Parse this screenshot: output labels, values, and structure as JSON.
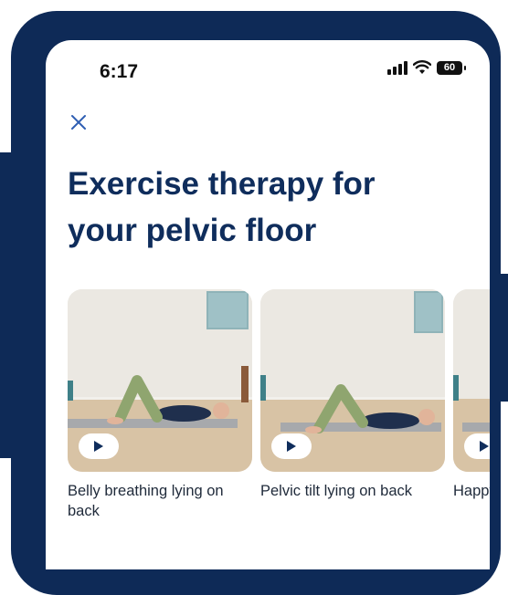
{
  "status_bar": {
    "time": "6:17",
    "battery": "60"
  },
  "page": {
    "title_line1": "Exercise therapy for",
    "title_line2": "your pelvic floor"
  },
  "exercises": [
    {
      "label": "Belly breathing lying on back"
    },
    {
      "label": "Pelvic tilt lying on back"
    },
    {
      "label": "Happy baby pelvic…"
    }
  ],
  "colors": {
    "navy": "#0e2a57",
    "title": "#0f2d5c",
    "accent": "#2f5fb3"
  },
  "icons": [
    "close-icon",
    "play-icon",
    "signal-icon",
    "wifi-icon",
    "battery-icon"
  ]
}
